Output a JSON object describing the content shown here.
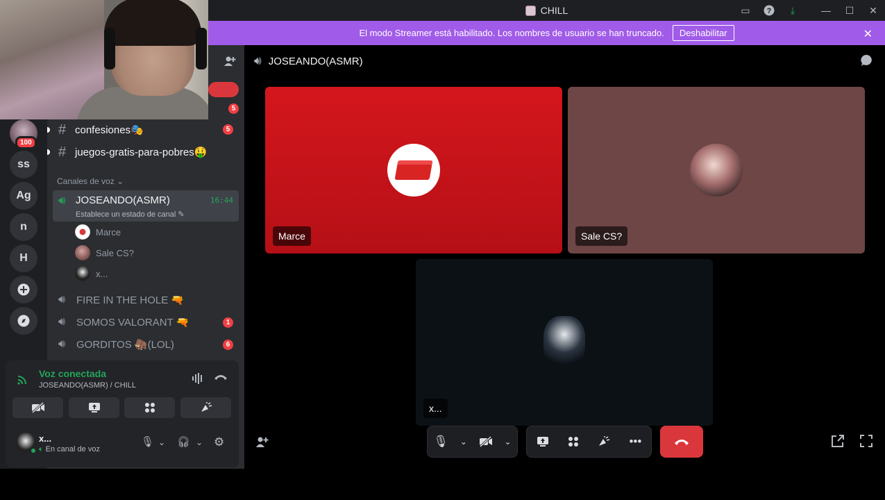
{
  "window": {
    "title": "CHILL"
  },
  "banner": {
    "message": "El modo Streamer está habilitado. Los nombres de usuario se han truncado.",
    "button": "Deshabilitar"
  },
  "rail": {
    "badge": "100",
    "servers": [
      "ss",
      "Ag",
      "n",
      "H"
    ]
  },
  "sidebar": {
    "text_channels": [
      {
        "name": "confesiones🎭",
        "badge": "5"
      },
      {
        "name": "juegos-gratis-para-pobres🤑",
        "badge": ""
      }
    ],
    "top_badges": [
      "5",
      "5"
    ],
    "voice_category": "Canales de voz",
    "active_voice": {
      "name": "JOSEANDO(ASMR)",
      "time": "16:44",
      "status": "Establece un estado de canal"
    },
    "members": [
      "Marce",
      "Sale CS?",
      "x..."
    ],
    "voice_channels": [
      {
        "name": "FIRE IN THE HOLE 🔫",
        "badge": ""
      },
      {
        "name": "SOMOS VALORANT 🔫",
        "badge": "1"
      },
      {
        "name": "GORDITOS 🦣(LOL)",
        "badge": "6"
      }
    ]
  },
  "voice_panel": {
    "status": "Voz conectada",
    "location": "JOSEANDO(ASMR) / CHILL"
  },
  "user": {
    "name": "x...",
    "status": "En canal de voz"
  },
  "call": {
    "channel": "JOSEANDO(ASMR)",
    "tiles": [
      "Marce",
      "Sale CS?",
      "x..."
    ]
  },
  "colors": {
    "banner": "#a15be9",
    "accent_green": "#23a55a",
    "danger": "#da373c"
  }
}
